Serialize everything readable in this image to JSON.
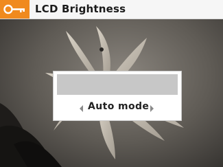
{
  "title_bar": {
    "title": "LCD Brightness",
    "icon": "key-icon",
    "accent_color": "#f08a1e"
  },
  "dialog": {
    "brightness_bar_color": "#c7c7c7",
    "mode_value": "Auto mode",
    "left_arrow_icon": "left-arrow-icon",
    "right_arrow_icon": "right-arrow-icon"
  }
}
